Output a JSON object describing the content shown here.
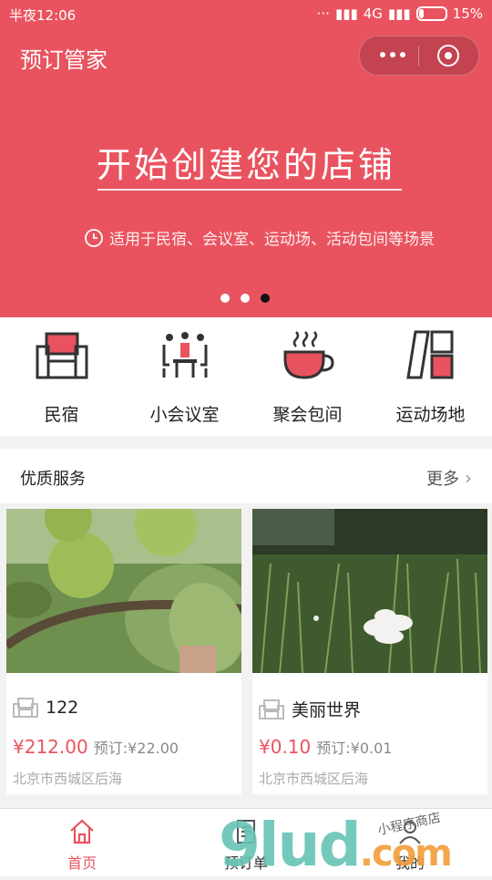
{
  "status": {
    "time": "半夜12:06",
    "network": "4G",
    "battery": "15%"
  },
  "app": {
    "title": "预订管家"
  },
  "banner": {
    "headline": "开始创建您的店铺",
    "subline": "适用于民宿、会议室、运动场、活动包间等场景",
    "pages": 3,
    "active_page": 3
  },
  "categories": [
    {
      "label": "民宿",
      "icon": "sofa-icon"
    },
    {
      "label": "小会议室",
      "icon": "meeting-icon"
    },
    {
      "label": "聚会包间",
      "icon": "cup-icon"
    },
    {
      "label": "运动场地",
      "icon": "field-icon"
    }
  ],
  "section": {
    "title": "优质服务",
    "more": "更多"
  },
  "products": [
    {
      "name": "122",
      "price": "¥212.00",
      "deposit": "预订:¥22.00",
      "address": "北京市西城区后海"
    },
    {
      "name": "美丽世界",
      "price": "¥0.10",
      "deposit": "预订:¥0.01",
      "address": "北京市西城区后海"
    }
  ],
  "tabs": [
    {
      "label": "首页",
      "icon": "home-icon",
      "active": true
    },
    {
      "label": "预订单",
      "icon": "order-icon",
      "active": false
    },
    {
      "label": "我的",
      "icon": "user-icon",
      "active": false
    }
  ],
  "watermark": {
    "brand": "9lud",
    "suffix": ".com",
    "tagline": "小程序商店"
  },
  "colors": {
    "accent": "#e9535f",
    "accent_dark": "#c44350"
  }
}
